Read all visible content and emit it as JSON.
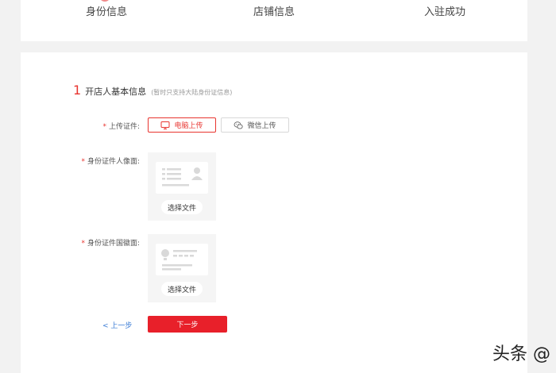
{
  "steps": [
    {
      "label": "身份信息"
    },
    {
      "label": "店铺信息"
    },
    {
      "label": "入驻成功"
    }
  ],
  "section": {
    "number": "1",
    "title": "开店人基本信息",
    "hint": "(暂时只支持大陆身份证信息)"
  },
  "fields": {
    "upload_method": {
      "label": "上传证件:",
      "options": [
        "电脑上传",
        "微信上传"
      ],
      "selected": "电脑上传"
    },
    "id_front": {
      "label": "身份证件人像面:",
      "button": "选择文件"
    },
    "id_back": {
      "label": "身份证件国徽面:",
      "button": "选择文件"
    }
  },
  "actions": {
    "prev": "< 上一步",
    "next": "下一步"
  },
  "watermark": "头条 @",
  "colors": {
    "accent": "#e8342f",
    "primary_button": "#e8202a",
    "link": "#3a7bd5",
    "page_bg": "#f2f2f2"
  }
}
